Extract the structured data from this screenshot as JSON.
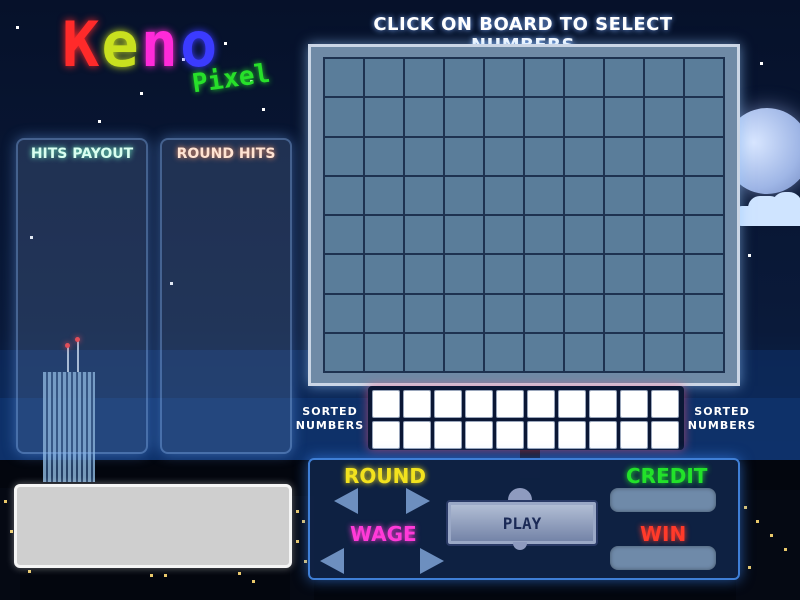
{
  "logo": {
    "letters": [
      "K",
      "e",
      "n",
      "o"
    ],
    "sub": "Pixel",
    "colors": [
      "#ff2a2a",
      "#c9e01f",
      "#ff2ad9",
      "#3b3bff"
    ]
  },
  "board": {
    "instruction": "CLICK ON BOARD TO SELECT NUMBERS",
    "rows": 8,
    "cols": 10
  },
  "panels": {
    "hits_payout": "HITS PAYOUT",
    "round_hits": "ROUND HITS"
  },
  "sorted": {
    "label_line1": "SORTED",
    "label_line2": "NUMBERS",
    "boxes": 20
  },
  "controls": {
    "round_label": "ROUND",
    "wage_label": "WAGE",
    "credit_label": "CREDIT",
    "win_label": "WIN",
    "play_label": "PLAY",
    "round_color": "#f2e21e",
    "wage_color": "#ff3ad8",
    "credit_color": "#22e22a",
    "win_color": "#ff3a2a"
  }
}
